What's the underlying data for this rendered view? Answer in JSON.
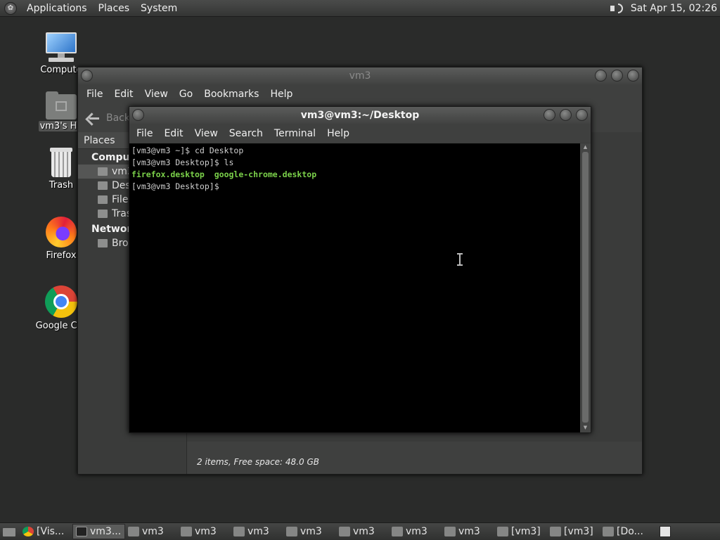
{
  "top_panel": {
    "menus": [
      "Applications",
      "Places",
      "System"
    ],
    "clock": "Sat Apr 15, 02:26"
  },
  "desktop_icons": [
    {
      "label": "Compute",
      "icon": "computer-icon"
    },
    {
      "label": "vm3's Ho",
      "icon": "home-folder-icon"
    },
    {
      "label": "Trash",
      "icon": "trash-icon"
    },
    {
      "label": "Firefox",
      "icon": "firefox-icon"
    },
    {
      "label": "Google Chr",
      "icon": "chrome-icon"
    }
  ],
  "file_manager": {
    "title": "vm3",
    "menu": [
      "File",
      "Edit",
      "View",
      "Go",
      "Bookmarks",
      "Help"
    ],
    "back_label": "Back",
    "places_header": "Places",
    "sidebar": {
      "computer_section": "Compute",
      "items": [
        "vm3",
        "Des",
        "File",
        "Tras"
      ],
      "network_section": "Network",
      "network_items": [
        "Bro"
      ]
    },
    "status": "2 items, Free space: 48.0 GB"
  },
  "terminal": {
    "title": "vm3@vm3:~/Desktop",
    "menu": [
      "File",
      "Edit",
      "View",
      "Search",
      "Terminal",
      "Help"
    ],
    "lines": [
      "[vm3@vm3 ~]$ cd Desktop",
      "[vm3@vm3 Desktop]$ ls",
      "",
      "[vm3@vm3 Desktop]$ "
    ],
    "ls_output": [
      "firefox.desktop",
      "google-chrome.desktop"
    ]
  },
  "taskbar": {
    "tasks": [
      "[Vis...",
      "vm3...",
      "vm3",
      "vm3",
      "vm3",
      "vm3",
      "vm3",
      "vm3",
      "vm3",
      "[vm3]",
      "[vm3]",
      "[Do..."
    ]
  },
  "colors": {
    "terminal_bg": "#000000",
    "ls_green": "#7bd14a",
    "panel": "#3c3d3c"
  }
}
